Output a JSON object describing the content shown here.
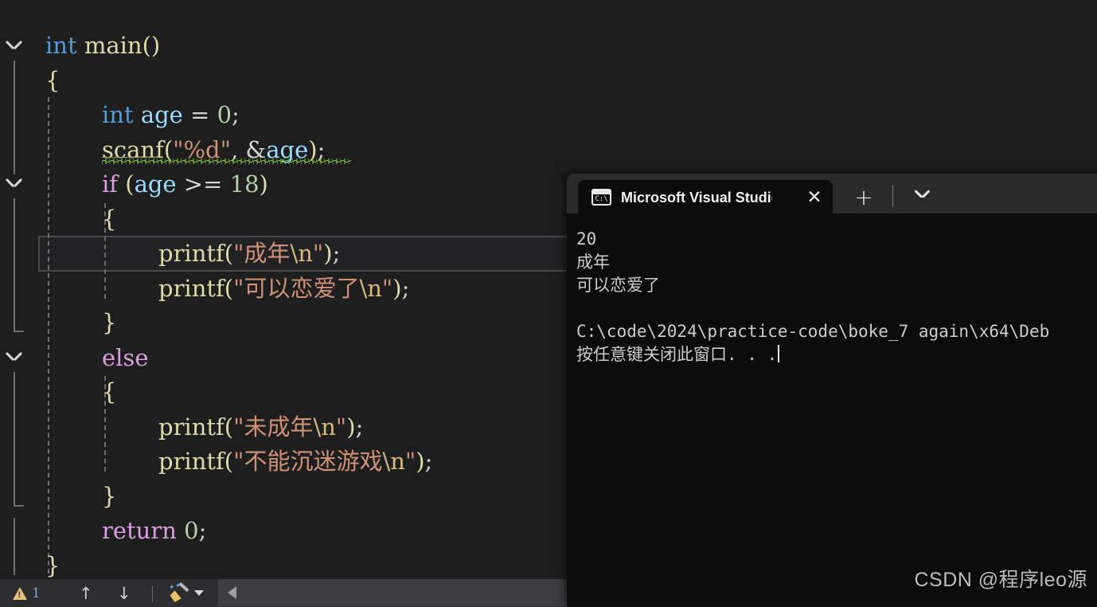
{
  "editor": {
    "name": "visual-studio-code-editor",
    "background": "#1e1e1e",
    "lines": [
      {
        "indent": 0,
        "tokens": [
          {
            "t": "int",
            "c": "k-type"
          },
          {
            "t": " ",
            "c": "k-op"
          },
          {
            "t": "main",
            "c": "k-fn"
          },
          {
            "t": "(",
            "c": "k-brace1"
          },
          {
            "t": ")",
            "c": "k-brace1"
          }
        ]
      },
      {
        "indent": 0,
        "tokens": [
          {
            "t": "{",
            "c": "k-brace1"
          }
        ]
      },
      {
        "indent": 1,
        "tokens": [
          {
            "t": "int",
            "c": "k-type"
          },
          {
            "t": " ",
            "c": "k-op"
          },
          {
            "t": "age",
            "c": "k-var"
          },
          {
            "t": " = ",
            "c": "k-op"
          },
          {
            "t": "0",
            "c": "k-num"
          },
          {
            "t": ";",
            "c": "k-punc"
          }
        ]
      },
      {
        "indent": 1,
        "tokens": [
          {
            "t": "scanf",
            "c": "k-fn"
          },
          {
            "t": "(",
            "c": "k-brace1"
          },
          {
            "t": "\"%d\"",
            "c": "k-str"
          },
          {
            "t": ", ",
            "c": "k-punc"
          },
          {
            "t": "&",
            "c": "k-op"
          },
          {
            "t": "age",
            "c": "k-var"
          },
          {
            "t": ")",
            "c": "k-brace1"
          },
          {
            "t": ";",
            "c": "k-punc"
          }
        ]
      },
      {
        "indent": 1,
        "tokens": [
          {
            "t": "if",
            "c": "k-ctrl"
          },
          {
            "t": " ",
            "c": "k-op"
          },
          {
            "t": "(",
            "c": "k-brace1"
          },
          {
            "t": "age",
            "c": "k-var"
          },
          {
            "t": " >= ",
            "c": "k-op"
          },
          {
            "t": "18",
            "c": "k-num"
          },
          {
            "t": ")",
            "c": "k-brace1"
          }
        ]
      },
      {
        "indent": 1,
        "tokens": [
          {
            "t": "{",
            "c": "k-brace1"
          }
        ]
      },
      {
        "indent": 2,
        "tokens": [
          {
            "t": "printf",
            "c": "k-fn"
          },
          {
            "t": "(",
            "c": "k-brace1"
          },
          {
            "t": "\"成年",
            "c": "k-str"
          },
          {
            "t": "\\n",
            "c": "k-esc"
          },
          {
            "t": "\"",
            "c": "k-str"
          },
          {
            "t": ")",
            "c": "k-brace1"
          },
          {
            "t": ";",
            "c": "k-punc"
          }
        ]
      },
      {
        "indent": 2,
        "tokens": [
          {
            "t": "printf",
            "c": "k-fn"
          },
          {
            "t": "(",
            "c": "k-brace1"
          },
          {
            "t": "\"可以恋爱了",
            "c": "k-str"
          },
          {
            "t": "\\n",
            "c": "k-esc"
          },
          {
            "t": "\"",
            "c": "k-str"
          },
          {
            "t": ")",
            "c": "k-brace1"
          },
          {
            "t": ";",
            "c": "k-punc"
          }
        ]
      },
      {
        "indent": 1,
        "tokens": [
          {
            "t": "}",
            "c": "k-brace1"
          }
        ]
      },
      {
        "indent": 1,
        "tokens": [
          {
            "t": "else",
            "c": "k-ctrl"
          }
        ]
      },
      {
        "indent": 1,
        "tokens": [
          {
            "t": "{",
            "c": "k-brace1"
          }
        ]
      },
      {
        "indent": 2,
        "tokens": [
          {
            "t": "printf",
            "c": "k-fn"
          },
          {
            "t": "(",
            "c": "k-brace1"
          },
          {
            "t": "\"未成年",
            "c": "k-str"
          },
          {
            "t": "\\n",
            "c": "k-esc"
          },
          {
            "t": "\"",
            "c": "k-str"
          },
          {
            "t": ")",
            "c": "k-brace1"
          },
          {
            "t": ";",
            "c": "k-punc"
          }
        ]
      },
      {
        "indent": 2,
        "tokens": [
          {
            "t": "printf",
            "c": "k-fn"
          },
          {
            "t": "(",
            "c": "k-brace1"
          },
          {
            "t": "\"不能沉迷游戏",
            "c": "k-str"
          },
          {
            "t": "\\n",
            "c": "k-esc"
          },
          {
            "t": "\"",
            "c": "k-str"
          },
          {
            "t": ")",
            "c": "k-brace1"
          },
          {
            "t": ";",
            "c": "k-punc"
          }
        ]
      },
      {
        "indent": 1,
        "tokens": [
          {
            "t": "}",
            "c": "k-brace1"
          }
        ]
      },
      {
        "indent": 1,
        "tokens": [
          {
            "t": "return",
            "c": "k-ctrl"
          },
          {
            "t": " ",
            "c": "k-op"
          },
          {
            "t": "0",
            "c": "k-num"
          },
          {
            "t": ";",
            "c": "k-punc"
          }
        ]
      },
      {
        "indent": 0,
        "tokens": [
          {
            "t": "}",
            "c": "k-brace1"
          }
        ]
      }
    ],
    "current_line_index": 6,
    "error_squiggle_line_index": 3,
    "colors": {
      "type_keyword": "#569cd6",
      "control_keyword": "#d8a0df",
      "function": "#dcdcaa",
      "variable": "#9cdcfe",
      "number": "#b5cea8",
      "string": "#ce9178",
      "escape": "#d7ba7d",
      "squiggle": "#7bbf3a"
    }
  },
  "status_bar": {
    "warning_icon": "warning-triangle-icon",
    "warning_count": "1",
    "prev_label": "↑",
    "next_label": "↓",
    "cleanup_icon": "broom-icon",
    "cleanup_caret": "chevron-down-icon",
    "scroll_left_icon": "triangle-left-icon"
  },
  "console_window": {
    "name": "microsoft-visual-studio-debug-console",
    "tab": {
      "icon": "command-prompt-icon",
      "icon_glyph": "C:\\",
      "title": "Microsoft Visual Studio 调试控",
      "close_label": "✕"
    },
    "toolbar": {
      "new_tab_label": "+",
      "dropdown_icon": "chevron-down-icon"
    },
    "output_lines": [
      "20",
      "成年",
      "可以恋爱了",
      "",
      "C:\\code\\2024\\practice-code\\boke_7 again\\x64\\Deb",
      "按任意键关闭此窗口. . ."
    ],
    "cursor_visible": true,
    "background": "#0c0c0c",
    "titlebar_background": "#2b2b2b"
  },
  "watermark": {
    "text": "CSDN @程序leo源"
  }
}
